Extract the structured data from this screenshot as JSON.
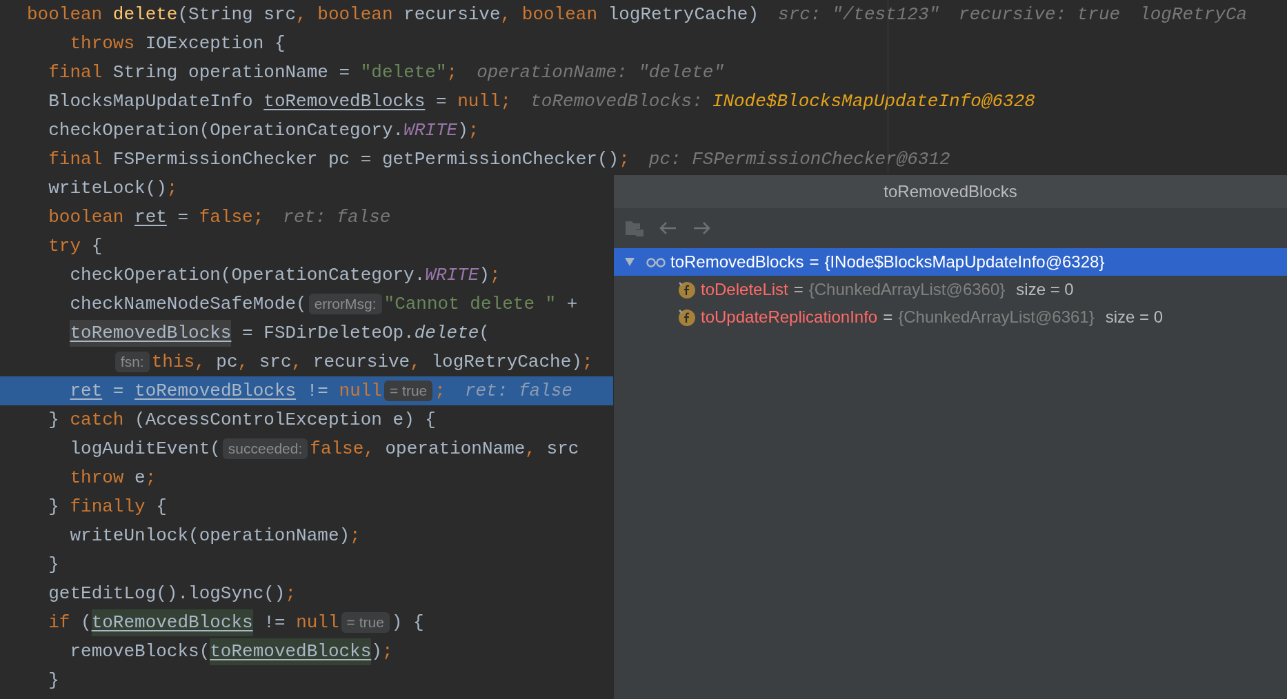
{
  "editor": {
    "lines": [
      {
        "current": false,
        "tokens": [
          {
            "kind": "keyword",
            "text": "boolean "
          },
          {
            "kind": "method",
            "text": "delete"
          },
          {
            "kind": "plain",
            "text": "(String src"
          },
          {
            "kind": "keyword",
            "text": ", "
          },
          {
            "kind": "keyword",
            "text": "boolean"
          },
          {
            "kind": "plain",
            "text": " recursive"
          },
          {
            "kind": "keyword",
            "text": ", "
          },
          {
            "kind": "keyword",
            "text": "boolean"
          },
          {
            "kind": "plain",
            "text": " logRetryCache)"
          },
          {
            "kind": "debug",
            "text": "src: \"/test123\""
          },
          {
            "kind": "debug",
            "text": "recursive: true"
          },
          {
            "kind": "debug",
            "text": "logRetryCa"
          }
        ]
      },
      {
        "current": false,
        "tokens": [
          {
            "kind": "keyword",
            "text": "    throws"
          },
          {
            "kind": "plain",
            "text": " IOException {"
          }
        ]
      },
      {
        "current": false,
        "tokens": [
          {
            "kind": "keyword",
            "text": "  final"
          },
          {
            "kind": "plain",
            "text": " String operationName = "
          },
          {
            "kind": "string",
            "text": "\"delete\""
          },
          {
            "kind": "keyword",
            "text": ";"
          },
          {
            "kind": "debug",
            "text": "operationName: \"delete\""
          }
        ]
      },
      {
        "current": false,
        "tokens": [
          {
            "kind": "plain",
            "text": "  BlocksMapUpdateInfo "
          },
          {
            "kind": "variable",
            "text": "toRemovedBlocks"
          },
          {
            "kind": "plain",
            "text": " = "
          },
          {
            "kind": "keyword",
            "text": "null;"
          },
          {
            "kind": "debug",
            "text": "toRemovedBlocks:"
          },
          {
            "kind": "debugvalue",
            "text": "INode$BlocksMapUpdateInfo@6328"
          }
        ]
      },
      {
        "current": false,
        "tokens": [
          {
            "kind": "plain",
            "text": "  checkOperation(OperationCategory."
          },
          {
            "kind": "constant",
            "text": "WRITE"
          },
          {
            "kind": "plain",
            "text": ")"
          },
          {
            "kind": "keyword",
            "text": ";"
          }
        ]
      },
      {
        "current": false,
        "tokens": [
          {
            "kind": "keyword",
            "text": "  final"
          },
          {
            "kind": "plain",
            "text": " FSPermissionChecker pc = getPermissionChecker()"
          },
          {
            "kind": "keyword",
            "text": ";"
          },
          {
            "kind": "debug",
            "text": "pc: FSPermissionChecker@6312"
          }
        ]
      },
      {
        "current": false,
        "tokens": [
          {
            "kind": "plain",
            "text": "  writeLock()"
          },
          {
            "kind": "keyword",
            "text": ";"
          }
        ]
      },
      {
        "current": false,
        "tokens": [
          {
            "kind": "keyword",
            "text": "  boolean "
          },
          {
            "kind": "variable",
            "text": "ret"
          },
          {
            "kind": "plain",
            "text": " = "
          },
          {
            "kind": "keyword",
            "text": "false;"
          },
          {
            "kind": "debug",
            "text": "ret: false"
          }
        ]
      },
      {
        "current": false,
        "tokens": [
          {
            "kind": "keyword",
            "text": "  try"
          },
          {
            "kind": "plain",
            "text": " {"
          }
        ]
      },
      {
        "current": false,
        "tokens": [
          {
            "kind": "plain",
            "text": "    checkOperation(OperationCategory."
          },
          {
            "kind": "constant",
            "text": "WRITE"
          },
          {
            "kind": "plain",
            "text": ")"
          },
          {
            "kind": "keyword",
            "text": ";"
          }
        ]
      },
      {
        "current": false,
        "tokens": [
          {
            "kind": "plain",
            "text": "    checkNameNodeSafeMode("
          },
          {
            "kind": "hint",
            "text": "errorMsg:"
          },
          {
            "kind": "string",
            "text": "\"Cannot delete \""
          },
          {
            "kind": "plain",
            "text": " +"
          }
        ]
      },
      {
        "current": false,
        "tokens": [
          {
            "kind": "written",
            "text": "    toRemovedBlocks"
          },
          {
            "kind": "plain",
            "text": " = FSDirDeleteOp."
          },
          {
            "kind": "static",
            "text": "delete"
          },
          {
            "kind": "plain",
            "text": "("
          }
        ]
      },
      {
        "current": false,
        "tokens": [
          {
            "kind": "hint",
            "text": "        fsn:"
          },
          {
            "kind": "keyword",
            "text": "this,"
          },
          {
            "kind": "plain",
            "text": " pc"
          },
          {
            "kind": "keyword",
            "text": ","
          },
          {
            "kind": "plain",
            "text": " src"
          },
          {
            "kind": "keyword",
            "text": ","
          },
          {
            "kind": "plain",
            "text": " recursive"
          },
          {
            "kind": "keyword",
            "text": ","
          },
          {
            "kind": "plain",
            "text": " logRetryCache)"
          },
          {
            "kind": "keyword",
            "text": ";"
          }
        ]
      },
      {
        "current": true,
        "tokens": [
          {
            "kind": "variable",
            "text": "    ret"
          },
          {
            "kind": "plain",
            "text": " = "
          },
          {
            "kind": "variable",
            "text": "toRemovedBlocks"
          },
          {
            "kind": "plain",
            "text": " != "
          },
          {
            "kind": "keyword",
            "text": "null"
          },
          {
            "kind": "eval",
            "text": "= true"
          },
          {
            "kind": "keyword",
            "text": ";"
          },
          {
            "kind": "debug",
            "text": "ret: false"
          }
        ]
      },
      {
        "current": false,
        "tokens": [
          {
            "kind": "plain",
            "text": "  } "
          },
          {
            "kind": "keyword",
            "text": "catch"
          },
          {
            "kind": "plain",
            "text": " (AccessControlException e) {"
          }
        ]
      },
      {
        "current": false,
        "tokens": [
          {
            "kind": "plain",
            "text": "    logAuditEvent("
          },
          {
            "kind": "hint",
            "text": "succeeded:"
          },
          {
            "kind": "keyword",
            "text": "false,"
          },
          {
            "kind": "plain",
            "text": " operationName"
          },
          {
            "kind": "keyword",
            "text": ","
          },
          {
            "kind": "plain",
            "text": " src"
          }
        ]
      },
      {
        "current": false,
        "tokens": [
          {
            "kind": "keyword",
            "text": "    throw"
          },
          {
            "kind": "plain",
            "text": " e"
          },
          {
            "kind": "keyword",
            "text": ";"
          }
        ]
      },
      {
        "current": false,
        "tokens": [
          {
            "kind": "plain",
            "text": "  } "
          },
          {
            "kind": "keyword",
            "text": "finally"
          },
          {
            "kind": "plain",
            "text": " {"
          }
        ]
      },
      {
        "current": false,
        "tokens": [
          {
            "kind": "plain",
            "text": "    writeUnlock(operationName)"
          },
          {
            "kind": "keyword",
            "text": ";"
          }
        ]
      },
      {
        "current": false,
        "tokens": [
          {
            "kind": "plain",
            "text": "  }"
          }
        ]
      },
      {
        "current": false,
        "tokens": [
          {
            "kind": "plain",
            "text": "  getEditLog().logSync()"
          },
          {
            "kind": "keyword",
            "text": ";"
          }
        ]
      },
      {
        "current": false,
        "tokens": [
          {
            "kind": "keyword",
            "text": "  if"
          },
          {
            "kind": "plain",
            "text": " ("
          },
          {
            "kind": "read",
            "text": "toRemovedBlocks"
          },
          {
            "kind": "plain",
            "text": " != "
          },
          {
            "kind": "keyword",
            "text": "null"
          },
          {
            "kind": "eval",
            "text": "= true"
          },
          {
            "kind": "plain",
            "text": ") {"
          }
        ]
      },
      {
        "current": false,
        "tokens": [
          {
            "kind": "plain",
            "text": "    removeBlocks("
          },
          {
            "kind": "read",
            "text": "toRemovedBlocks"
          },
          {
            "kind": "plain",
            "text": ")"
          },
          {
            "kind": "keyword",
            "text": ";"
          }
        ]
      },
      {
        "current": false,
        "tokens": [
          {
            "kind": "plain",
            "text": "  }"
          }
        ]
      }
    ]
  },
  "popup": {
    "title": "toRemovedBlocks",
    "tree": [
      {
        "kind": "watch",
        "name": "toRemovedBlocks",
        "separator": "=",
        "value": "{INode$BlocksMapUpdateInfo@6328}",
        "expanded": true,
        "selected": true,
        "children": [
          {
            "kind": "field",
            "name": "toDeleteList",
            "separator": "=",
            "value": "{ChunkedArrayList@6360}",
            "size": "size = 0",
            "selected": false
          },
          {
            "kind": "field",
            "name": "toUpdateReplicationInfo",
            "separator": "=",
            "value": "{ChunkedArrayList@6361}",
            "size": "size = 0",
            "selected": false
          }
        ]
      }
    ]
  }
}
